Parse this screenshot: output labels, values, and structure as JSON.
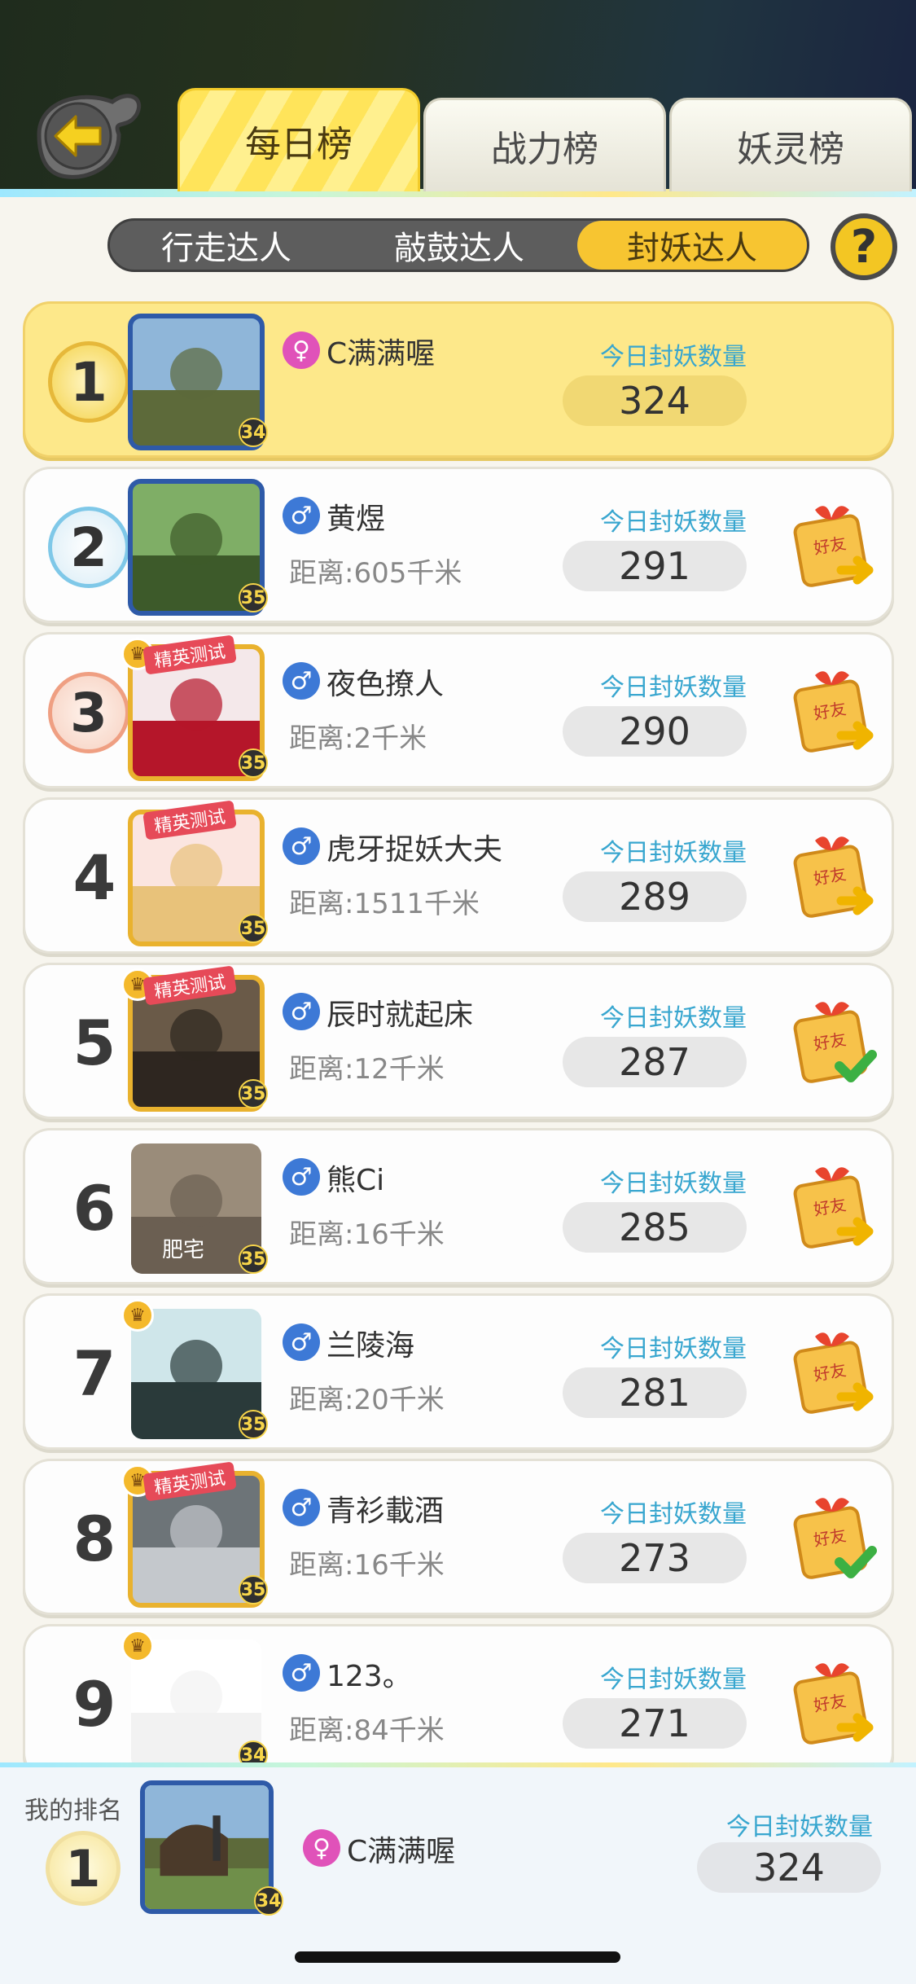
{
  "tabs": [
    {
      "label": "每日榜",
      "active": true
    },
    {
      "label": "战力榜",
      "active": false
    },
    {
      "label": "妖灵榜",
      "active": false
    }
  ],
  "sub_tabs": [
    {
      "label": "行走达人",
      "active": false
    },
    {
      "label": "敲鼓达人",
      "active": false
    },
    {
      "label": "封妖达人",
      "active": true
    }
  ],
  "help_label": "?",
  "count_label": "今日封妖数量",
  "rows": [
    {
      "rank": "1",
      "name": "C满满喔",
      "gender": "female",
      "gender_symbol": "♀",
      "distance": "",
      "count": "324",
      "level": "34",
      "friend_state": "none"
    },
    {
      "rank": "2",
      "name": "黄煜",
      "gender": "male",
      "gender_symbol": "♂",
      "distance": "距离:605千米",
      "count": "291",
      "level": "35",
      "friend_state": "add"
    },
    {
      "rank": "3",
      "name": "夜色撩人",
      "gender": "male",
      "gender_symbol": "♂",
      "distance": "距离:2千米",
      "count": "290",
      "level": "35",
      "friend_state": "add"
    },
    {
      "rank": "4",
      "name": "虎牙捉妖大夫",
      "gender": "male",
      "gender_symbol": "♂",
      "distance": "距离:1511千米",
      "count": "289",
      "level": "35",
      "friend_state": "add"
    },
    {
      "rank": "5",
      "name": "辰时就起床",
      "gender": "male",
      "gender_symbol": "♂",
      "distance": "距离:12千米",
      "count": "287",
      "level": "35",
      "friend_state": "added"
    },
    {
      "rank": "6",
      "name": "熊Ci",
      "gender": "male",
      "gender_symbol": "♂",
      "distance": "距离:16千米",
      "count": "285",
      "level": "35",
      "friend_state": "add",
      "avatar_caption": "肥宅"
    },
    {
      "rank": "7",
      "name": "兰陵海",
      "gender": "male",
      "gender_symbol": "♂",
      "distance": "距离:20千米",
      "count": "281",
      "level": "35",
      "friend_state": "add"
    },
    {
      "rank": "8",
      "name": "青衫載酒",
      "gender": "male",
      "gender_symbol": "♂",
      "distance": "距离:16千米",
      "count": "273",
      "level": "35",
      "friend_state": "added"
    },
    {
      "rank": "9",
      "name": "123。",
      "gender": "male",
      "gender_symbol": "♂",
      "distance": "距离:84千米",
      "count": "271",
      "level": "34",
      "friend_state": "add"
    }
  ],
  "ribbon_label": "精英测试",
  "friend_label": "好友",
  "my_rank": {
    "label": "我的排名",
    "rank": "1",
    "name": "C满满喔",
    "gender_symbol": "♀",
    "level": "34",
    "count_label": "今日封妖数量",
    "count": "324"
  },
  "colors": {
    "accent_yellow": "#f7c531",
    "count_label_blue": "#38a6cf",
    "male_blue": "#3d79d6",
    "female_pink": "#e052b9"
  }
}
